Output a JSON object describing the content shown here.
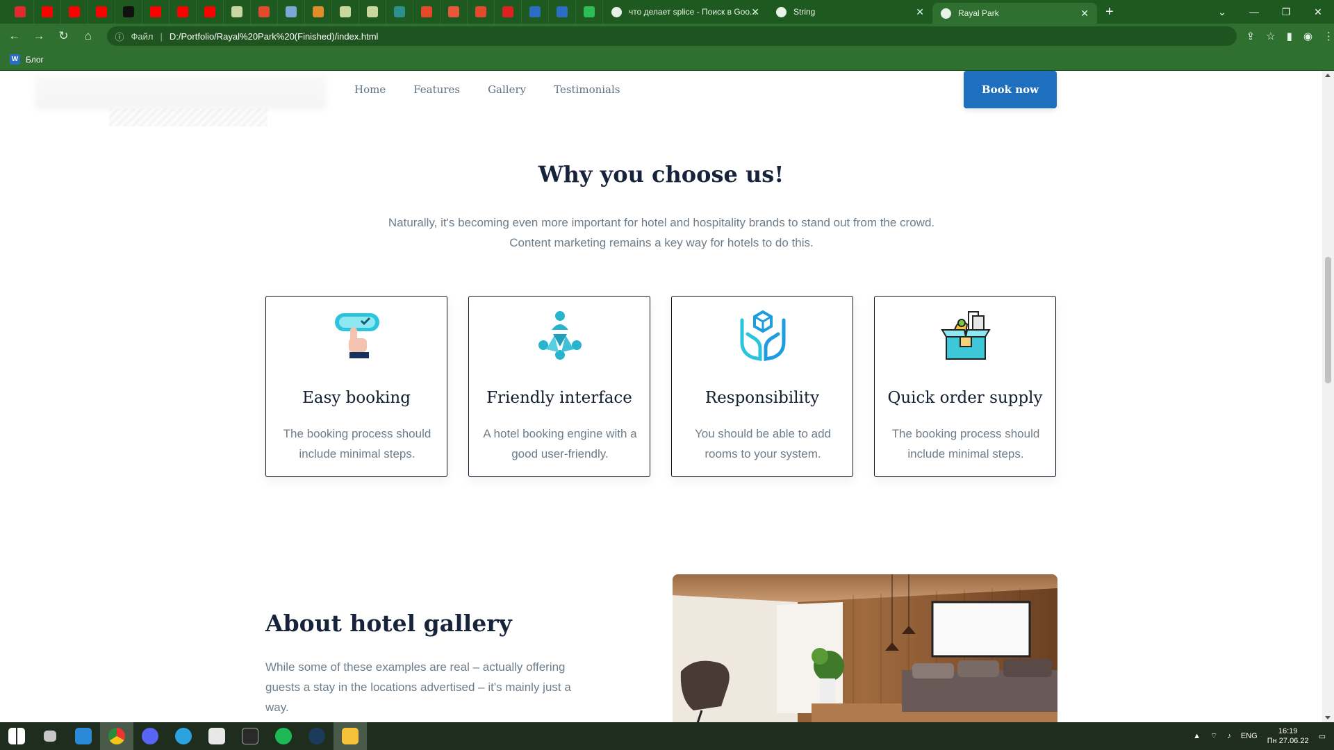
{
  "browser": {
    "pinned_tab_colors": [
      "#e2292f",
      "#ff0000",
      "#ff0000",
      "#ff0000",
      "#111111",
      "#ff0000",
      "#ff0000",
      "#ff0000",
      "#c9d6a0",
      "#e34a2c",
      "#7aa8d8",
      "#e08d2a",
      "#c9d6a0",
      "#c9d6a0",
      "#2d8f8f",
      "#e44a2a",
      "#e8563b",
      "#e34a2c",
      "#e02020",
      "#2b6cc4",
      "#2b6cc4",
      "#2dbe5a"
    ],
    "tabs": [
      {
        "title": "что делает splice - Поиск в Goo..."
      },
      {
        "title": "String"
      },
      {
        "title": "Rayal Park"
      }
    ],
    "address": {
      "scheme_label": "Файл",
      "url": "D:/Portfolio/Rayal%20Park%20(Finished)/index.html"
    },
    "bookmarks": [
      {
        "icon": "W",
        "label": "Блог"
      }
    ],
    "theme_color": "#2f6f2f"
  },
  "site": {
    "nav": [
      "Home",
      "Features",
      "Gallery",
      "Testimonials"
    ],
    "cta": "Book now",
    "why": {
      "title": "Why you choose us!",
      "subtitle": "Naturally, it's becoming even more important for hotel and hospitality brands to stand out from the crowd. Content marketing remains a key way for hotels to do this."
    },
    "cards": [
      {
        "icon": "touch-button-icon",
        "title": "Easy booking",
        "text": "The booking process should include minimal steps."
      },
      {
        "icon": "team-network-icon",
        "title": "Friendly interface",
        "text": "A hotel booking engine with a good user-friendly."
      },
      {
        "icon": "hands-cube-icon",
        "title": "Responsibility",
        "text": "You should be able to add rooms to your system."
      },
      {
        "icon": "supply-box-icon",
        "title": "Quick order supply",
        "text": "The booking process should include minimal steps."
      }
    ],
    "about": {
      "title": "About hotel gallery",
      "text": "While some of these examples are real – actually offering guests a stay in the locations advertised – it's mainly just a way."
    },
    "accent": "#1f6fbf"
  },
  "taskbar": {
    "apps": [
      "windows-start-icon",
      "task-view-icon",
      "vscode-icon",
      "chrome-icon",
      "discord-icon",
      "telegram-icon",
      "unity-icon",
      "epic-games-icon",
      "spotify-icon",
      "steam-icon",
      "file-explorer-icon"
    ],
    "lang": "ENG",
    "time": "16:19",
    "date": "Пн 27.06.22"
  }
}
